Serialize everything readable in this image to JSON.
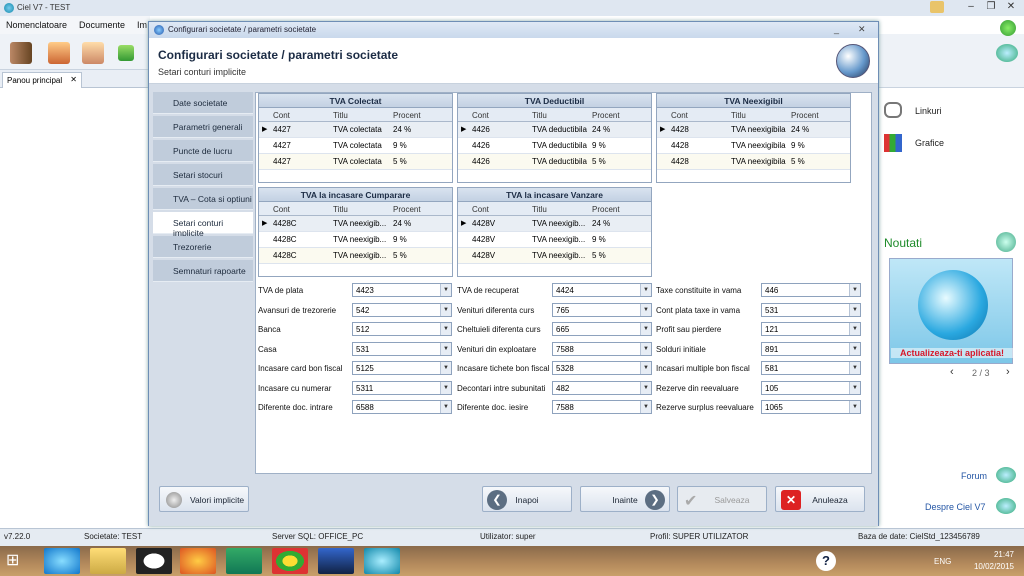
{
  "app": {
    "title": "Ciel V7 - TEST",
    "menu": [
      "Nomenclatoare",
      "Documente",
      "Im"
    ],
    "tab": "Panou principal",
    "right_links": [
      "Linkuri",
      "Grafice"
    ],
    "noutati": "Noutati",
    "promo_text": "Actualizeaza-ti aplicatia!",
    "pager": "2 / 3",
    "forum": "Forum",
    "despre": "Despre Ciel V7"
  },
  "status": {
    "version": "v7.22.0",
    "societate": "Societate: TEST",
    "server": "Server SQL: OFFICE_PC",
    "utilizator": "Utilizator: super",
    "profil": "Profil: SUPER UTILIZATOR",
    "baza": "Baza de date: CielStd_123456789"
  },
  "taskbar": {
    "time": "21:47",
    "date": "10/02/2015",
    "lang": "ENG"
  },
  "dialog": {
    "window_title": "Configurari societate / parametri societate",
    "heading": "Configurari societate / parametri societate",
    "subheading": "Setari conturi implicite",
    "nav": [
      "Date societate",
      "Parametri generali",
      "Puncte de lucru",
      "Setari stocuri",
      "TVA – Cota si optiuni",
      "Setari conturi implicite",
      "Trezorerie",
      "Semnaturi rapoarte"
    ],
    "nav_active": 5,
    "grid_headers": {
      "cont": "Cont",
      "titlu": "Titlu",
      "procent": "Procent"
    },
    "grids": [
      {
        "title": "TVA Colectat",
        "rows": [
          [
            "4427",
            "TVA colectata",
            "24 %"
          ],
          [
            "4427",
            "TVA colectata",
            "9 %"
          ],
          [
            "4427",
            "TVA colectata",
            "5 %"
          ]
        ]
      },
      {
        "title": "TVA Deductibil",
        "rows": [
          [
            "4426",
            "TVA deductibila",
            "24 %"
          ],
          [
            "4426",
            "TVA deductibila",
            "9 %"
          ],
          [
            "4426",
            "TVA deductibila",
            "5 %"
          ]
        ]
      },
      {
        "title": "TVA Neexigibil",
        "rows": [
          [
            "4428",
            "TVA neexigibila",
            "24 %"
          ],
          [
            "4428",
            "TVA neexigibila",
            "9 %"
          ],
          [
            "4428",
            "TVA neexigibila",
            "5 %"
          ]
        ]
      },
      {
        "title": "TVA la incasare Cumparare",
        "rows": [
          [
            "4428C",
            "TVA neexigib...",
            "24 %"
          ],
          [
            "4428C",
            "TVA neexigib...",
            "9 %"
          ],
          [
            "4428C",
            "TVA neexigib...",
            "5 %"
          ]
        ]
      },
      {
        "title": "TVA la incasare Vanzare",
        "rows": [
          [
            "4428V",
            "TVA neexigib...",
            "24 %"
          ],
          [
            "4428V",
            "TVA neexigib...",
            "9 %"
          ],
          [
            "4428V",
            "TVA neexigib...",
            "5 %"
          ]
        ]
      }
    ],
    "fields": [
      [
        {
          "label": "TVA de plata",
          "value": "4423"
        },
        {
          "label": "Avansuri de trezorerie",
          "value": "542"
        },
        {
          "label": "Banca",
          "value": "512"
        },
        {
          "label": "Casa",
          "value": "531"
        },
        {
          "label": "Incasare card bon fiscal",
          "value": "5125"
        },
        {
          "label": "Incasare cu numerar",
          "value": "5311"
        },
        {
          "label": "Diferente doc. intrare",
          "value": "6588"
        }
      ],
      [
        {
          "label": "TVA de recuperat",
          "value": "4424"
        },
        {
          "label": "Venituri diferenta curs",
          "value": "765"
        },
        {
          "label": "Cheltuieli diferenta curs",
          "value": "665"
        },
        {
          "label": "Venituri din exploatare",
          "value": "7588"
        },
        {
          "label": "Incasare tichete bon fiscal",
          "value": "5328"
        },
        {
          "label": "Decontari intre subunitati",
          "value": "482"
        },
        {
          "label": "Diferente doc. iesire",
          "value": "7588"
        }
      ],
      [
        {
          "label": "Taxe constituite in vama",
          "value": "446"
        },
        {
          "label": "Cont plata taxe in vama",
          "value": "531"
        },
        {
          "label": "Profit sau pierdere",
          "value": "121"
        },
        {
          "label": "Solduri initiale",
          "value": "891"
        },
        {
          "label": "Incasari multiple bon fiscal",
          "value": "581"
        },
        {
          "label": "Rezerve din reevaluare",
          "value": "105"
        },
        {
          "label": "Rezerve surplus reevaluare",
          "value": "1065"
        }
      ]
    ],
    "buttons": {
      "defaults": "Valori implicite",
      "back": "Inapoi",
      "next": "Inainte",
      "save": "Salveaza",
      "cancel": "Anuleaza"
    }
  }
}
